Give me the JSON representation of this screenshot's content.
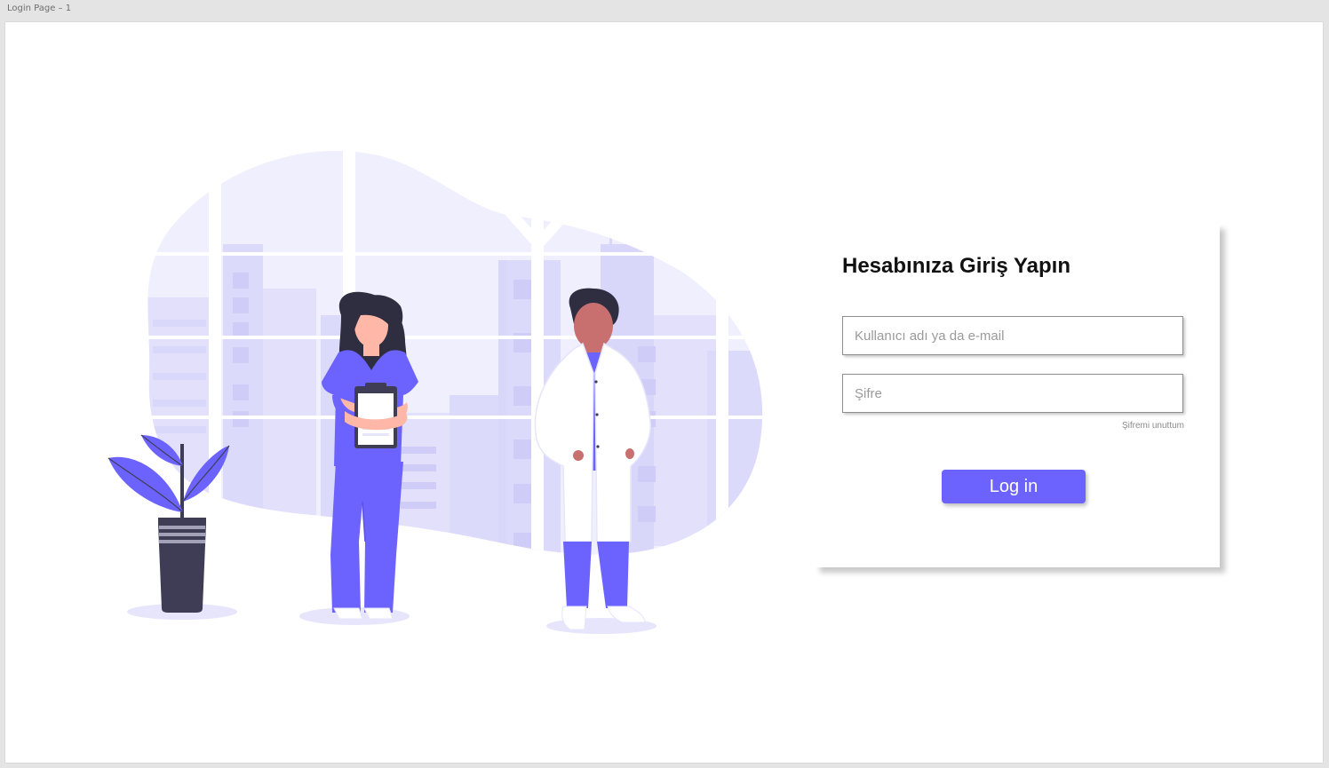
{
  "artboard": {
    "label": "Login Page – 1"
  },
  "login": {
    "title": "Hesabınıza Giriş Yapın",
    "username_placeholder": "Kullanıcı adı ya da e-mail",
    "password_placeholder": "Şifre",
    "forgot_label": "Şifremi unuttum",
    "login_button_label": "Log in"
  },
  "colors": {
    "accent": "#6c63ff",
    "background_blob": "#e6e5fc",
    "buildings": "#d6d4f9",
    "dark": "#3f3d56",
    "skin": "#ffb8a8",
    "doctor_skin": "#c87070",
    "hair": "#2f2e41",
    "coat": "#ffffff"
  },
  "icons": {
    "illustration": "medical-staff-illustration"
  }
}
